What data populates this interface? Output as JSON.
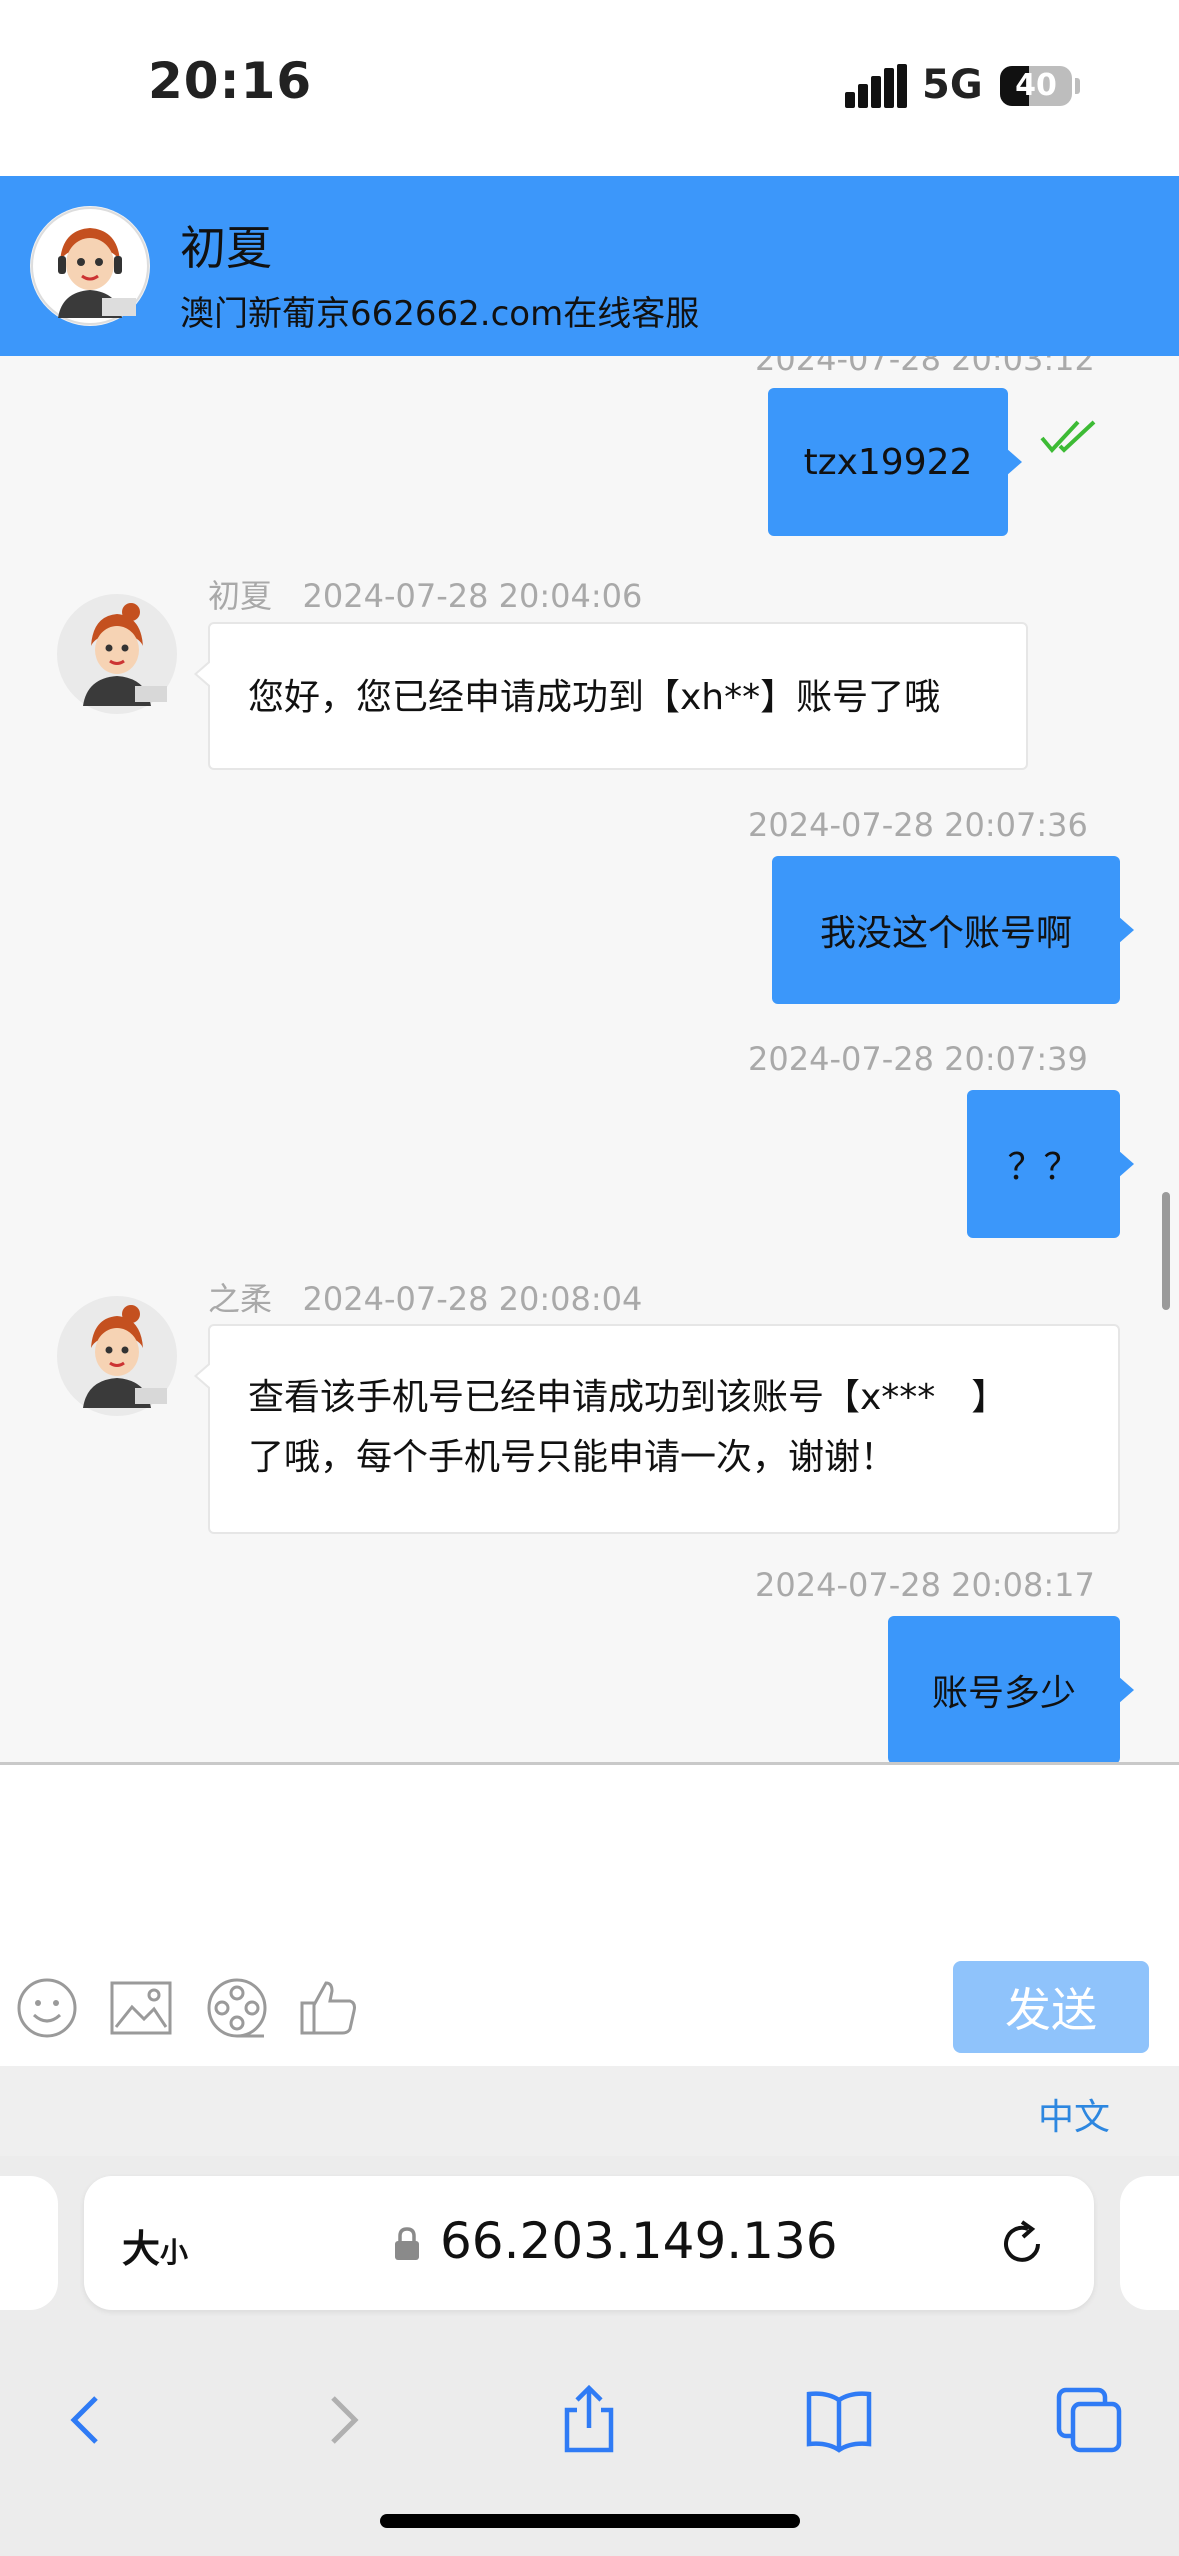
{
  "status": {
    "time": "20:16",
    "network": "5G",
    "battery": "40",
    "battery_level": 0.4
  },
  "header": {
    "name": "初夏",
    "subtitle": "澳门新葡京662662.com在线客服"
  },
  "messages": [
    {
      "dir": "out",
      "time": "2024-07-28 20:03:12",
      "text": "tzx19922",
      "read": true
    },
    {
      "dir": "in",
      "sender": "初夏",
      "time": "2024-07-28 20:04:06",
      "text": "您好，您已经申请成功到【xh**】账号了哦"
    },
    {
      "dir": "out",
      "time": "2024-07-28 20:07:36",
      "text": "我没这个账号啊"
    },
    {
      "dir": "out",
      "time": "2024-07-28 20:07:39",
      "text": "？？"
    },
    {
      "dir": "in",
      "sender": "之柔",
      "time": "2024-07-28 20:08:04",
      "lines": [
        "查看该手机号已经申请成功到该账号【x***　】",
        "了哦，每个手机号只能申请一次，谢谢！"
      ]
    },
    {
      "dir": "out",
      "time": "2024-07-28 20:08:17",
      "text": "账号多少"
    }
  ],
  "composer": {
    "placeholder": "",
    "send_label": "发送",
    "tools": [
      "emoji-icon",
      "image-icon",
      "video-icon",
      "thumbs-up-icon"
    ]
  },
  "keyboard": {
    "language": "中文"
  },
  "browser": {
    "aa_big": "大",
    "aa_small": "小",
    "url": "66.203.149.136"
  }
}
